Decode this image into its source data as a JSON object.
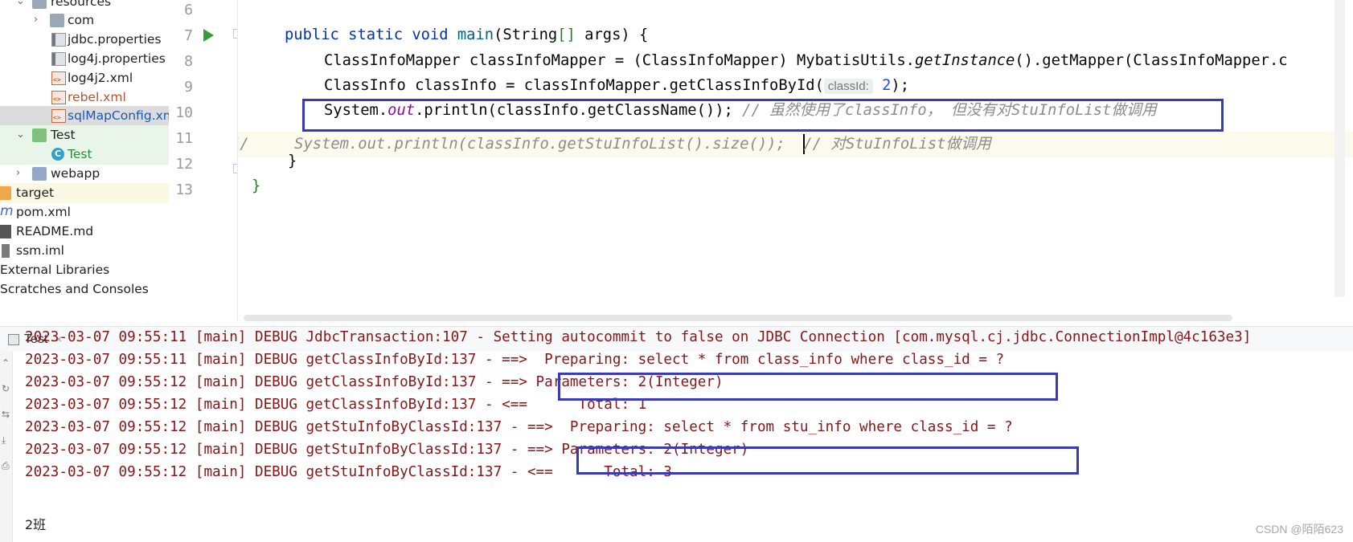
{
  "project_tree": {
    "items": [
      {
        "label": "resources",
        "icon": "resources-folder-icon"
      },
      {
        "label": "com",
        "icon": "package-folder-icon"
      },
      {
        "label": "jdbc.properties",
        "icon": "properties-file-icon"
      },
      {
        "label": "log4j.properties",
        "icon": "properties-file-icon"
      },
      {
        "label": "log4j2.xml",
        "icon": "xml-file-icon"
      },
      {
        "label": "rebel.xml",
        "icon": "xml-file-icon"
      },
      {
        "label": "sqlMapConfig.xm",
        "icon": "xml-file-icon"
      },
      {
        "label": "Test",
        "icon": "test-folder-icon"
      },
      {
        "label": "Test",
        "icon": "class-icon"
      },
      {
        "label": "webapp",
        "icon": "web-folder-icon"
      },
      {
        "label": "target",
        "icon": "excluded-folder-icon"
      },
      {
        "label": "pom.xml",
        "icon": "maven-icon"
      },
      {
        "label": "README.md",
        "icon": "markdown-icon"
      },
      {
        "label": "ssm.iml",
        "icon": "module-file-icon"
      },
      {
        "label": "External Libraries",
        "icon": ""
      },
      {
        "label": "Scratches and Consoles",
        "icon": ""
      }
    ]
  },
  "editor": {
    "line_numbers": [
      "6",
      "7",
      "8",
      "9",
      "10",
      "11",
      "12",
      "13"
    ],
    "line7": {
      "kw1": "public",
      "kw2": "static",
      "kw3": "void",
      "fn": "main",
      "p1": "(String",
      "br": "[]",
      "p2": " args) {"
    },
    "line8": {
      "a": "ClassInfoMapper classInfoMapper = (ClassInfoMapper) MybatisUtils.",
      "m": "getInstance",
      "b": "().getMapper(ClassInfoMapper.c"
    },
    "line9": {
      "a": "ClassInfo classInfo = classInfoMapper.getClassInfoById(",
      "hint": "classId:",
      "num": "2",
      "b": ");"
    },
    "line10": {
      "a": "System.",
      "st": "out",
      "b": ".println(classInfo.getClassName()); ",
      "c": "// 虽然使用了classInfo， 但没有对StuInfoList做调用"
    },
    "line11": {
      "c": "//     System.out.println(classInfo.getStuInfoList().size());  // 对StuInfoList做调用"
    },
    "line12": {
      "t": "}"
    },
    "line13": {
      "t": "}"
    }
  },
  "run_panel": {
    "tab_label": "Test",
    "log_lines": [
      "2023-03-07 09:55:11 [main] DEBUG JdbcTransaction:107 - Setting autocommit to false on JDBC Connection [com.mysql.cj.jdbc.ConnectionImpl@4c163e3]",
      "2023-03-07 09:55:11 [main] DEBUG getClassInfoById:137 - ==>  Preparing: select * from class_info where class_id = ?",
      "2023-03-07 09:55:12 [main] DEBUG getClassInfoById:137 - ==> Parameters: 2(Integer)",
      "2023-03-07 09:55:12 [main] DEBUG getClassInfoById:137 - <==      Total: 1",
      "2023-03-07 09:55:12 [main] DEBUG getStuInfoByClassId:137 - ==>  Preparing: select * from stu_info where class_id = ?",
      "2023-03-07 09:55:12 [main] DEBUG getStuInfoByClassId:137 - ==> Parameters: 2(Integer)",
      "2023-03-07 09:55:12 [main] DEBUG getStuInfoByClassId:137 - <==      Total: 3"
    ],
    "output": "2班"
  },
  "watermark": "CSDN @陌陌623",
  "colors": {
    "highlight_box": "#3a3ab8",
    "log_text": "#8a1515",
    "keyword": "#0033b3"
  }
}
